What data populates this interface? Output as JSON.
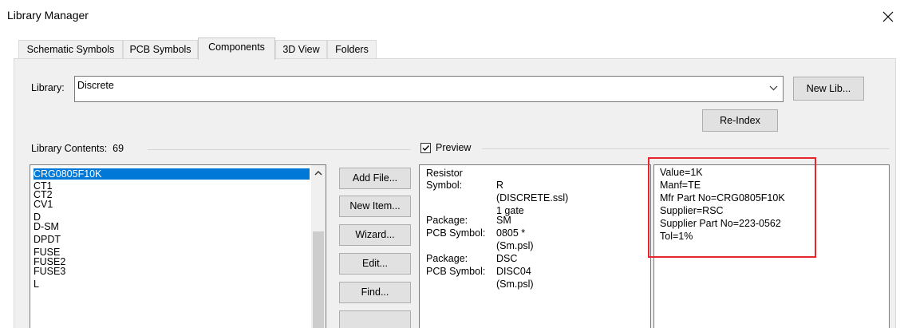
{
  "window": {
    "title": "Library Manager"
  },
  "tabs": [
    {
      "label": "Schematic Symbols"
    },
    {
      "label": "PCB Symbols"
    },
    {
      "label": "Components",
      "active": true
    },
    {
      "label": "3D View"
    },
    {
      "label": "Folders"
    }
  ],
  "library": {
    "label": "Library:",
    "selected": "Discrete",
    "new_lib_label": "New Lib...",
    "reindex_label": "Re-Index"
  },
  "contents": {
    "label": "Library Contents:",
    "count": "69",
    "items": [
      "CRG0805F10K",
      "CT1",
      "CT2",
      "CV1",
      "D",
      "D-SM",
      "DPDT",
      "FUSE",
      "FUSE2",
      "FUSE3",
      "L"
    ],
    "selected_index": 0
  },
  "buttons": {
    "add_file": "Add File...",
    "new_item": "New Item...",
    "wizard": "Wizard...",
    "edit": "Edit...",
    "find": "Find..."
  },
  "preview": {
    "checkbox_label": "Preview",
    "checked": true,
    "lines": [
      {
        "key": "Resistor",
        "value": ""
      },
      {
        "key": "Symbol:",
        "value": "R"
      },
      {
        "key": "",
        "value": "(DISCRETE.ssl)"
      },
      {
        "key": "",
        "value": "1 gate"
      },
      {
        "key": "Package:",
        "value": "SM"
      },
      {
        "key": "PCB Symbol:",
        "value": "0805 *"
      },
      {
        "key": "",
        "value": "(Sm.psl)"
      },
      {
        "key": "Package:",
        "value": "DSC"
      },
      {
        "key": "PCB Symbol:",
        "value": "DISC04"
      },
      {
        "key": "",
        "value": "(Sm.psl)"
      }
    ]
  },
  "attributes": [
    "Value=1K",
    "Manf=TE",
    "Mfr Part No=CRG0805F10K",
    "Supplier=RSC",
    "Supplier Part No=223-0562",
    "Tol=1%"
  ],
  "colors": {
    "selection": "#0078d7",
    "highlight": "#e8262b",
    "dialog_bg": "#f0f0f0"
  }
}
